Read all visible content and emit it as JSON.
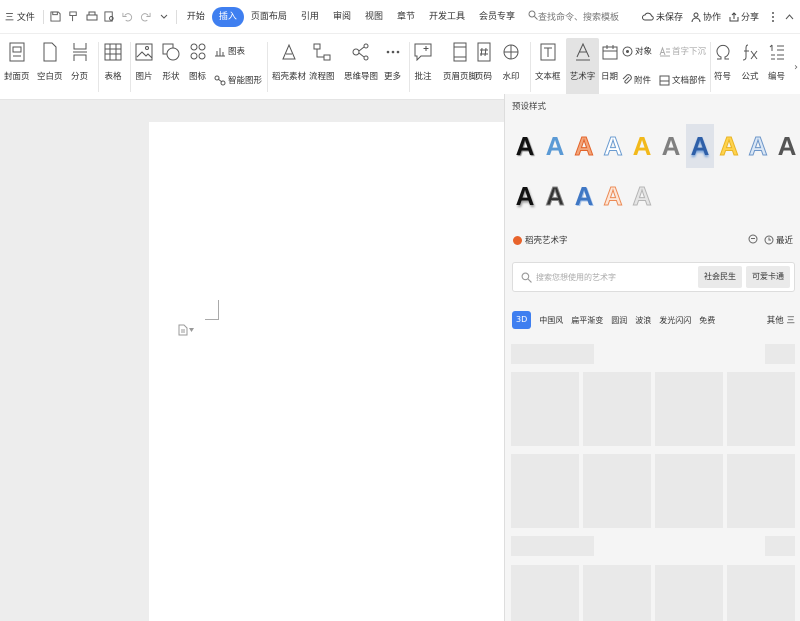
{
  "menubar": {
    "file_label": "三 文件",
    "tabs": [
      {
        "label": "开始"
      },
      {
        "label": "插入",
        "active": true
      },
      {
        "label": "页面布局"
      },
      {
        "label": "引用"
      },
      {
        "label": "审阅"
      },
      {
        "label": "视图"
      },
      {
        "label": "章节"
      },
      {
        "label": "开发工具"
      },
      {
        "label": "会员专享"
      }
    ],
    "search_label": "查找命令、搜索模板",
    "unsaved_label": "未保存",
    "collab_label": "协作",
    "share_label": "分享"
  },
  "ribbon": {
    "cover_page": "封面页",
    "blank_page": "空白页",
    "page_break": "分页",
    "table": "表格",
    "picture": "图片",
    "shape": "形状",
    "icon": "图标",
    "chart": "图表",
    "smart_art": "智能图形",
    "daoke_material": "稻壳素材",
    "flowchart": "流程图",
    "mind_map": "思维导图",
    "more": "更多",
    "comment": "批注",
    "header_footer": "页眉页脚",
    "page_number": "页码",
    "watermark": "水印",
    "text_box": "文本框",
    "word_art": "艺术字",
    "date": "日期",
    "object": "对象",
    "drop_cap": "首字下沉",
    "attachment": "附件",
    "doc_parts": "文档部件",
    "symbol": "符号",
    "formula": "公式",
    "numbering": "编号"
  },
  "panel": {
    "preset_title": "预设样式",
    "art_letter": "A",
    "daoke_title": "稻壳艺术字",
    "recent_label": "最近",
    "search_placeholder": "搜索您想使用的艺术字",
    "chip1": "社会民生",
    "chip2": "可爱卡通",
    "categories": [
      {
        "label": "3D",
        "active": true
      },
      {
        "label": "中国风"
      },
      {
        "label": "扁平渐变"
      },
      {
        "label": "圆润"
      },
      {
        "label": "波浪"
      },
      {
        "label": "发光闪闪"
      },
      {
        "label": "免费"
      }
    ],
    "more_label": "其他 三"
  },
  "colors": {
    "accent": "#3f7ff0",
    "daoke_logo": "#e8632b"
  }
}
